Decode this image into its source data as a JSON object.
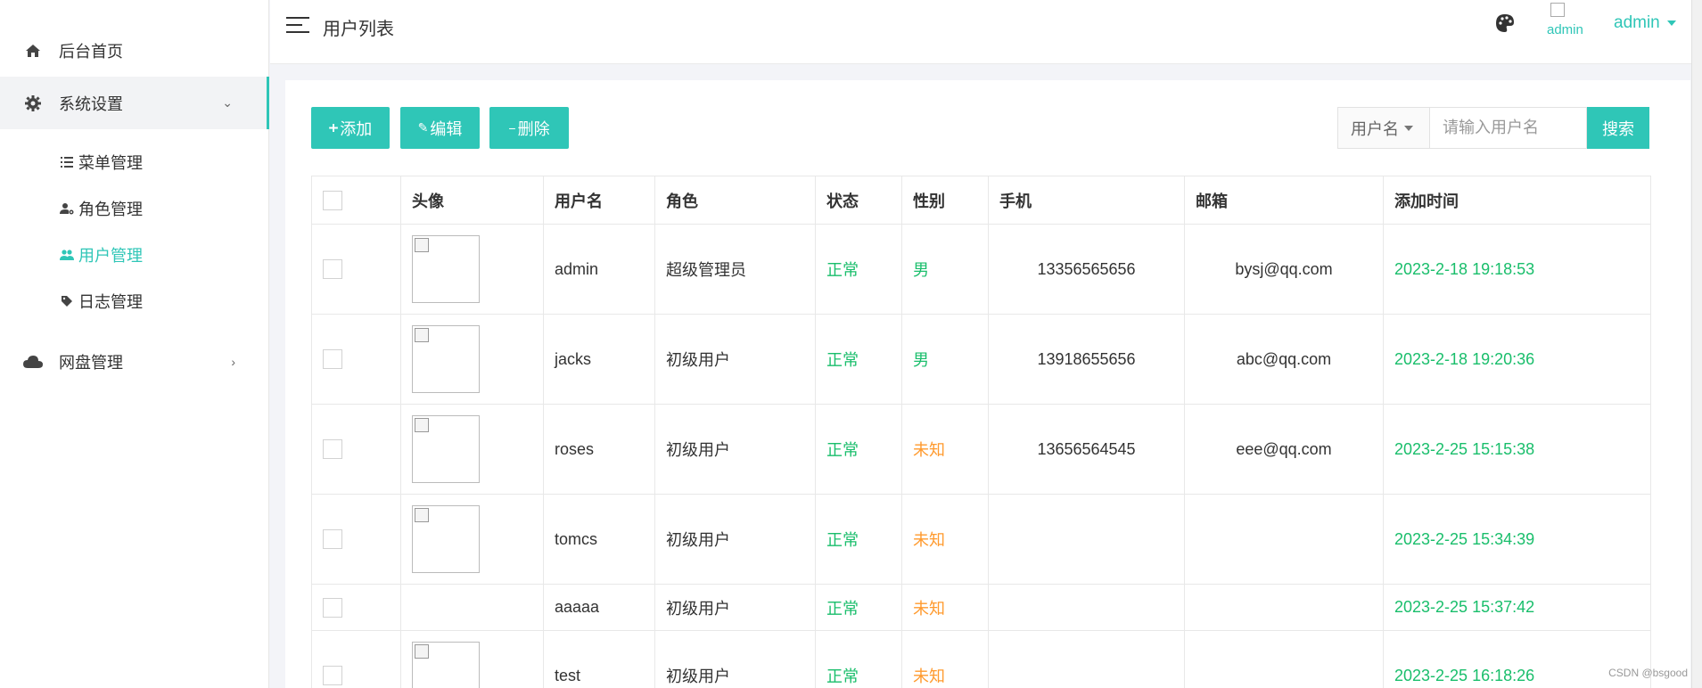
{
  "sidebar": {
    "items": [
      {
        "label": "后台首页"
      },
      {
        "label": "系统设置"
      },
      {
        "label": "网盘管理"
      }
    ],
    "sub_items": [
      {
        "label": "菜单管理"
      },
      {
        "label": "角色管理"
      },
      {
        "label": "用户管理"
      },
      {
        "label": "日志管理"
      }
    ]
  },
  "header": {
    "title": "用户列表",
    "avatar_alt": "admin",
    "user_name": "admin"
  },
  "toolbar": {
    "add_label": "添加",
    "edit_label": "编辑",
    "delete_label": "删除"
  },
  "search": {
    "field_label": "用户名",
    "placeholder": "请输入用户名",
    "button_label": "搜索"
  },
  "table": {
    "columns": [
      "头像",
      "用户名",
      "角色",
      "状态",
      "性别",
      "手机",
      "邮箱",
      "添加时间"
    ],
    "rows": [
      {
        "username": "admin",
        "role": "超级管理员",
        "status": "正常",
        "gender": "男",
        "phone": "13356565656",
        "email": "bysj@qq.com",
        "added": "2023-2-18 19:18:53"
      },
      {
        "username": "jacks",
        "role": "初级用户",
        "status": "正常",
        "gender": "男",
        "phone": "13918655656",
        "email": "abc@qq.com",
        "added": "2023-2-18 19:20:36"
      },
      {
        "username": "roses",
        "role": "初级用户",
        "status": "正常",
        "gender": "未知",
        "phone": "13656564545",
        "email": "eee@qq.com",
        "added": "2023-2-25 15:15:38"
      },
      {
        "username": "tomcs",
        "role": "初级用户",
        "status": "正常",
        "gender": "未知",
        "phone": "",
        "email": "",
        "added": "2023-2-25 15:34:39"
      },
      {
        "username": "aaaaa",
        "role": "初级用户",
        "status": "正常",
        "gender": "未知",
        "phone": "",
        "email": "",
        "added": "2023-2-25 15:37:42"
      },
      {
        "username": "test",
        "role": "初级用户",
        "status": "正常",
        "gender": "未知",
        "phone": "",
        "email": "",
        "added": "2023-2-25 16:18:26"
      }
    ]
  },
  "watermark": "CSDN @bsgood",
  "colors": {
    "accent": "#2fc6b7",
    "status_ok": "#19be6b",
    "unknown": "#ff9a2e"
  }
}
